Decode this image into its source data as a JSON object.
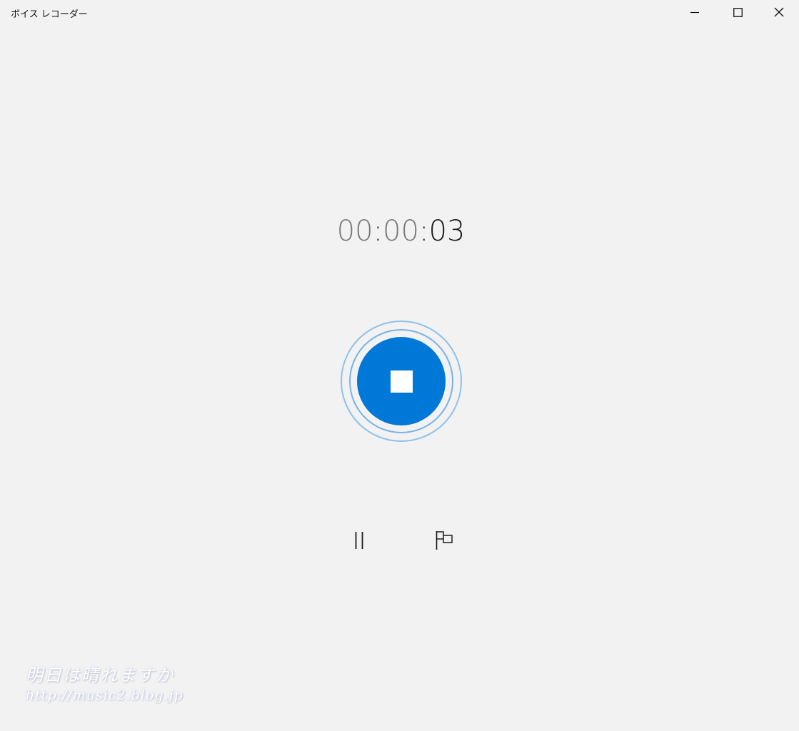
{
  "window": {
    "title": "ボイス レコーダー",
    "controls": {
      "minimize_icon": "minimize-icon",
      "maximize_icon": "maximize-icon",
      "close_icon": "close-icon"
    }
  },
  "timer": {
    "hours": "00",
    "separator1": ":",
    "minutes": "00",
    "separator2": ":",
    "seconds": "03"
  },
  "record": {
    "icon": "stop-icon",
    "accent_color": "#0078d7",
    "ring_color": "#8ec1ea"
  },
  "controls": {
    "pause_icon": "pause-icon",
    "marker_icon": "flag-icon"
  },
  "watermark": {
    "line1": "明日は晴れますか",
    "line2": "http://music2.blog.jp"
  }
}
